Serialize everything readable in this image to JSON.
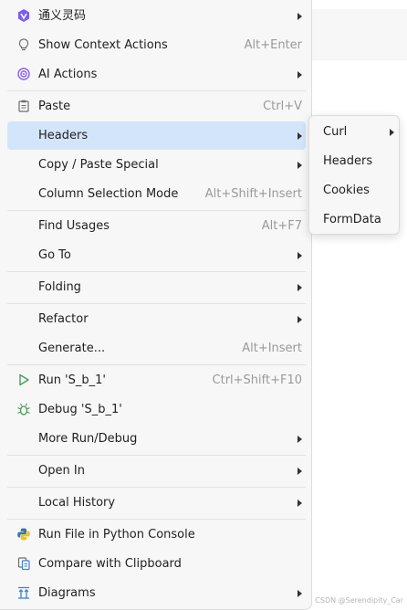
{
  "menu": {
    "items": [
      {
        "label": "通义灵码",
        "icon": "tongyi-lingma-icon",
        "submenu": true
      },
      {
        "label": "Show Context Actions",
        "icon": "lightbulb-icon",
        "shortcut": "Alt+Enter"
      },
      {
        "label": "AI Actions",
        "icon": "ai-assistant-icon",
        "submenu": true
      },
      {
        "label": "Paste",
        "icon": "clipboard-icon",
        "shortcut": "Ctrl+V"
      },
      {
        "label": "Headers",
        "submenu": true,
        "selected": true
      },
      {
        "label": "Copy / Paste Special",
        "submenu": true
      },
      {
        "label": "Column Selection Mode",
        "shortcut": "Alt+Shift+Insert"
      },
      {
        "label": "Find Usages",
        "shortcut": "Alt+F7"
      },
      {
        "label": "Go To",
        "submenu": true
      },
      {
        "label": "Folding",
        "submenu": true
      },
      {
        "label": "Refactor",
        "submenu": true
      },
      {
        "label": "Generate...",
        "shortcut": "Alt+Insert"
      },
      {
        "label": "Run 'S_b_1'",
        "icon": "run-icon",
        "shortcut": "Ctrl+Shift+F10"
      },
      {
        "label": "Debug 'S_b_1'",
        "icon": "debug-icon"
      },
      {
        "label": "More Run/Debug",
        "submenu": true
      },
      {
        "label": "Open In",
        "submenu": true
      },
      {
        "label": "Local History",
        "submenu": true
      },
      {
        "label": "Run File in Python Console",
        "icon": "python-icon"
      },
      {
        "label": "Compare with Clipboard",
        "icon": "compare-icon"
      },
      {
        "label": "Diagrams",
        "icon": "diagram-icon",
        "submenu": true
      }
    ]
  },
  "submenu": {
    "items": [
      {
        "label": "Curl",
        "submenu": true
      },
      {
        "label": "Headers"
      },
      {
        "label": "Cookies"
      },
      {
        "label": "FormData"
      }
    ]
  },
  "watermark": "CSDN @Serendipity_Car",
  "colors": {
    "selection": "#d3e5fb",
    "shortcut": "#999999",
    "run_green": "#4a9b5a",
    "ai_purple": "#8b5cf6"
  }
}
